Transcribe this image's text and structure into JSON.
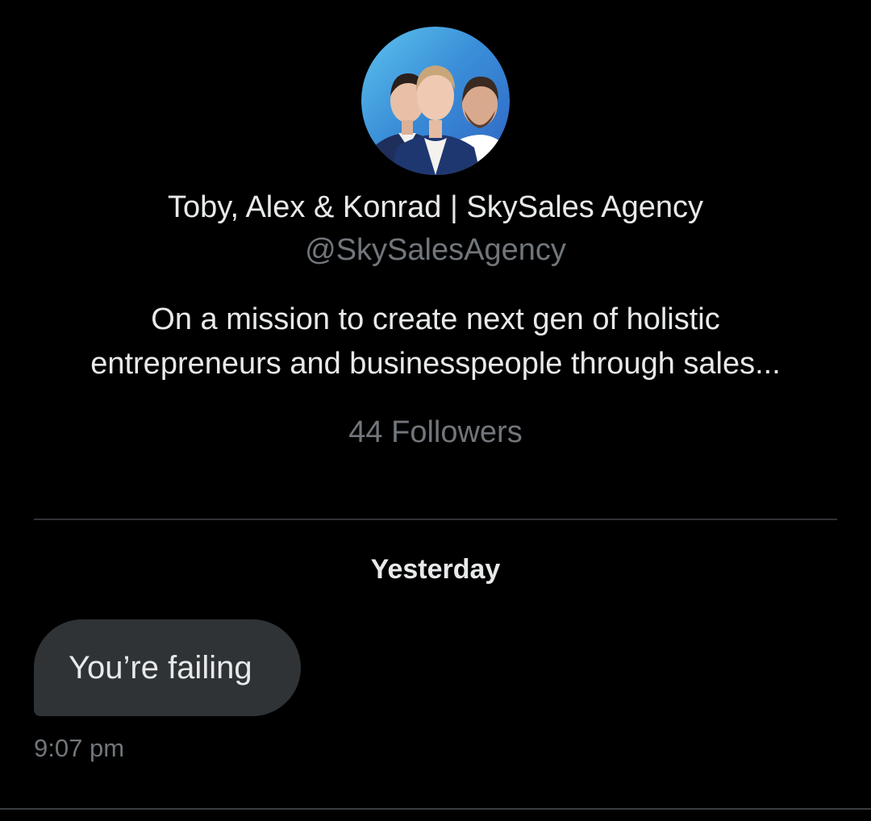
{
  "profile": {
    "avatar_alt": "Profile picture",
    "display_name": "Toby, Alex & Konrad | SkySales Agency",
    "handle": "@SkySalesAgency",
    "bio_lines": [
      "On a mission to create next gen of holistic",
      "entrepreneurs and businesspeople through sales..."
    ],
    "followers": "44 Followers"
  },
  "conversation": {
    "day_label": "Yesterday",
    "messages": [
      {
        "text": "You’re failing",
        "time": "9:07 pm"
      }
    ]
  },
  "colors": {
    "background": "#000000",
    "primary_text": "#e7e9ea",
    "secondary_text": "#71767b",
    "bubble": "#2f3336",
    "divider": "#2f3336"
  }
}
